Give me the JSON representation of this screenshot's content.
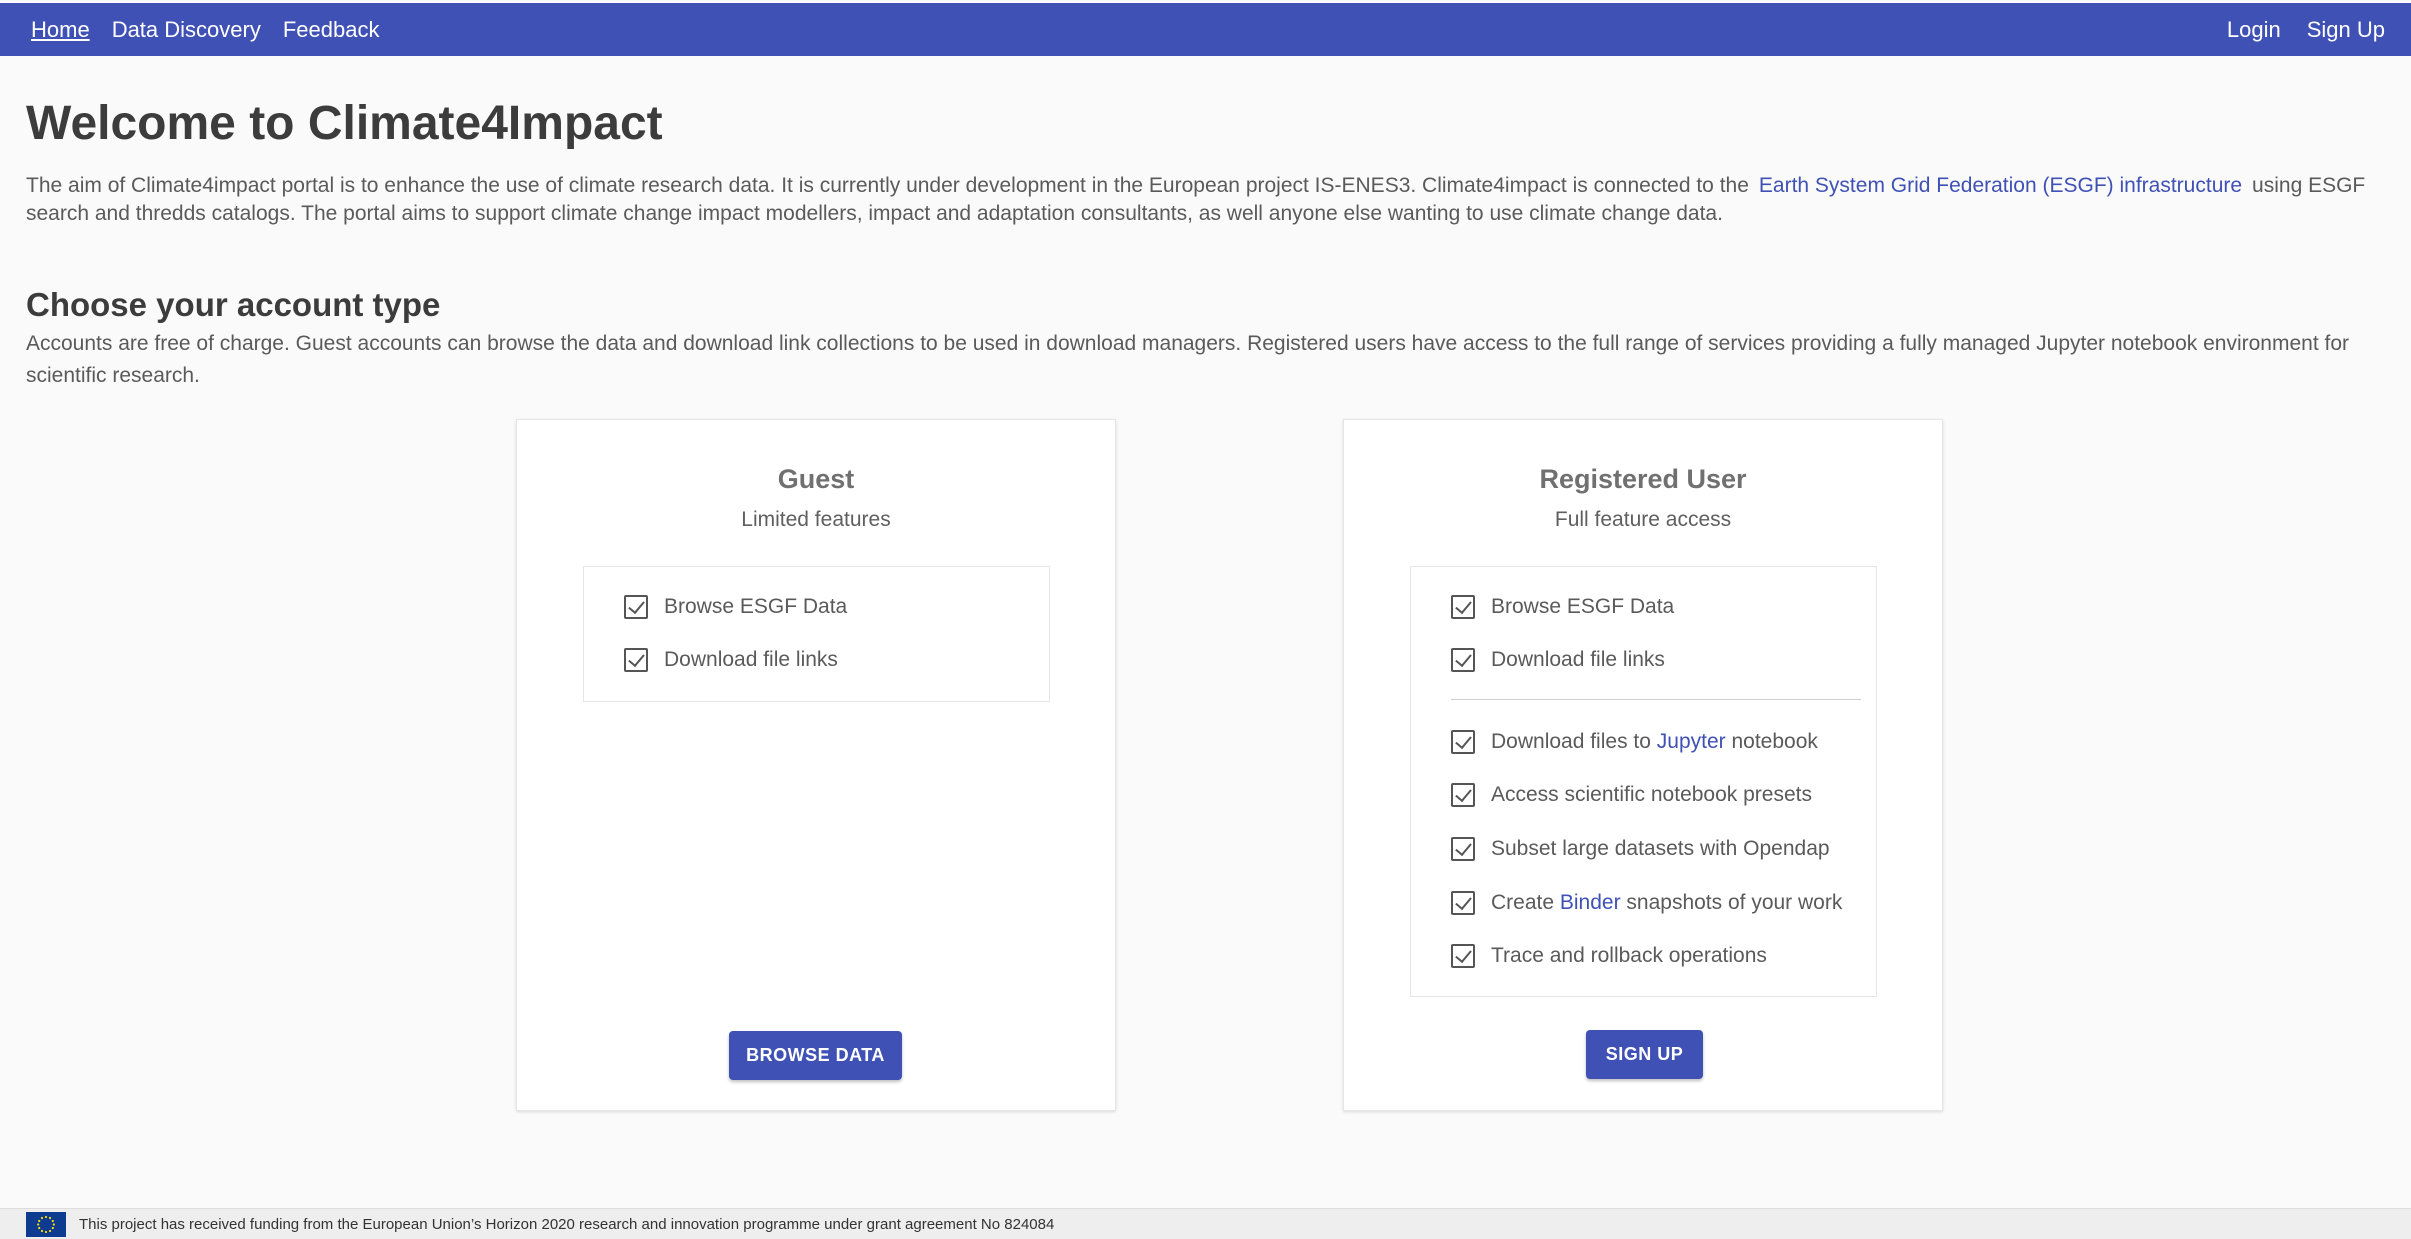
{
  "nav": {
    "links": [
      {
        "label": "Home",
        "active": true
      },
      {
        "label": "Data Discovery",
        "active": false
      },
      {
        "label": "Feedback",
        "active": false
      }
    ],
    "login": "Login",
    "signup": "Sign Up"
  },
  "page": {
    "title": "Welcome to Climate4Impact",
    "intro_before": "The aim of Climate4impact portal is to enhance the use of climate research data. It is currently under development in the European project IS-ENES3. Climate4impact is connected to the",
    "intro_link": "Earth System Grid Federation (ESGF) infrastructure",
    "intro_after": "using ESGF search and thredds catalogs. The portal aims to support climate change impact modellers, impact and adaptation consultants, as well anyone else wanting to use climate change data.",
    "account_heading": "Choose your account type",
    "account_text": "Accounts are free of charge. Guest accounts can browse the data and download link collections to be used in download managers. Registered users have access to the full range of services providing a fully managed Jupyter notebook environment for scientific research."
  },
  "guest": {
    "title": "Guest",
    "subtitle": "Limited features",
    "features": [
      "Browse ESGF Data",
      "Download file links"
    ],
    "button": "BROWSE DATA"
  },
  "registered": {
    "title": "Registered User",
    "subtitle": "Full feature access",
    "features_basic": [
      "Browse ESGF Data",
      "Download file links"
    ],
    "f1_before": "Download files to ",
    "f1_link": "Jupyter",
    "f1_after": " notebook",
    "f2": "Access scientific notebook presets",
    "f3": "Subset large datasets with Opendap",
    "f4_before": "Create ",
    "f4_link": "Binder",
    "f4_after": " snapshots of your work",
    "f5": "Trace and rollback operations",
    "button": "SIGN UP"
  },
  "footer": {
    "text": "This project has received funding from the European Union’s Horizon 2020 research and innovation programme under grant agreement No 824084"
  },
  "colors": {
    "primary": "#3f51b5",
    "background": "#fafafa",
    "flag": "#0d3b8f"
  }
}
